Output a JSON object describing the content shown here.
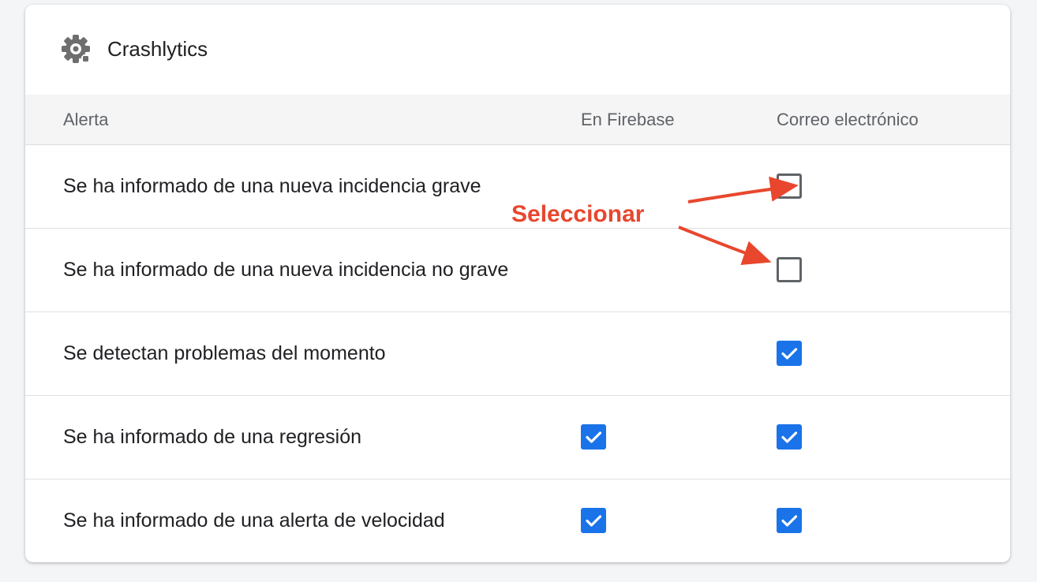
{
  "card": {
    "title": "Crashlytics",
    "icon": "crashlytics-gear-icon"
  },
  "columns": {
    "alert": "Alerta",
    "firebase": "En Firebase",
    "email": "Correo electrónico"
  },
  "rows": [
    {
      "label": "Se ha informado de una nueva incidencia grave",
      "in_firebase": null,
      "email": false
    },
    {
      "label": "Se ha informado de una nueva incidencia no grave",
      "in_firebase": null,
      "email": false
    },
    {
      "label": "Se detectan problemas del momento",
      "in_firebase": null,
      "email": true
    },
    {
      "label": "Se ha informado de una regresión",
      "in_firebase": true,
      "email": true
    },
    {
      "label": "Se ha informado de una alerta de velocidad",
      "in_firebase": true,
      "email": true
    }
  ],
  "annotation": {
    "text": "Seleccionar",
    "color": "#e8472e"
  },
  "colors": {
    "checkbox_checked": "#1a73e8",
    "checkbox_border": "#5f6368"
  }
}
